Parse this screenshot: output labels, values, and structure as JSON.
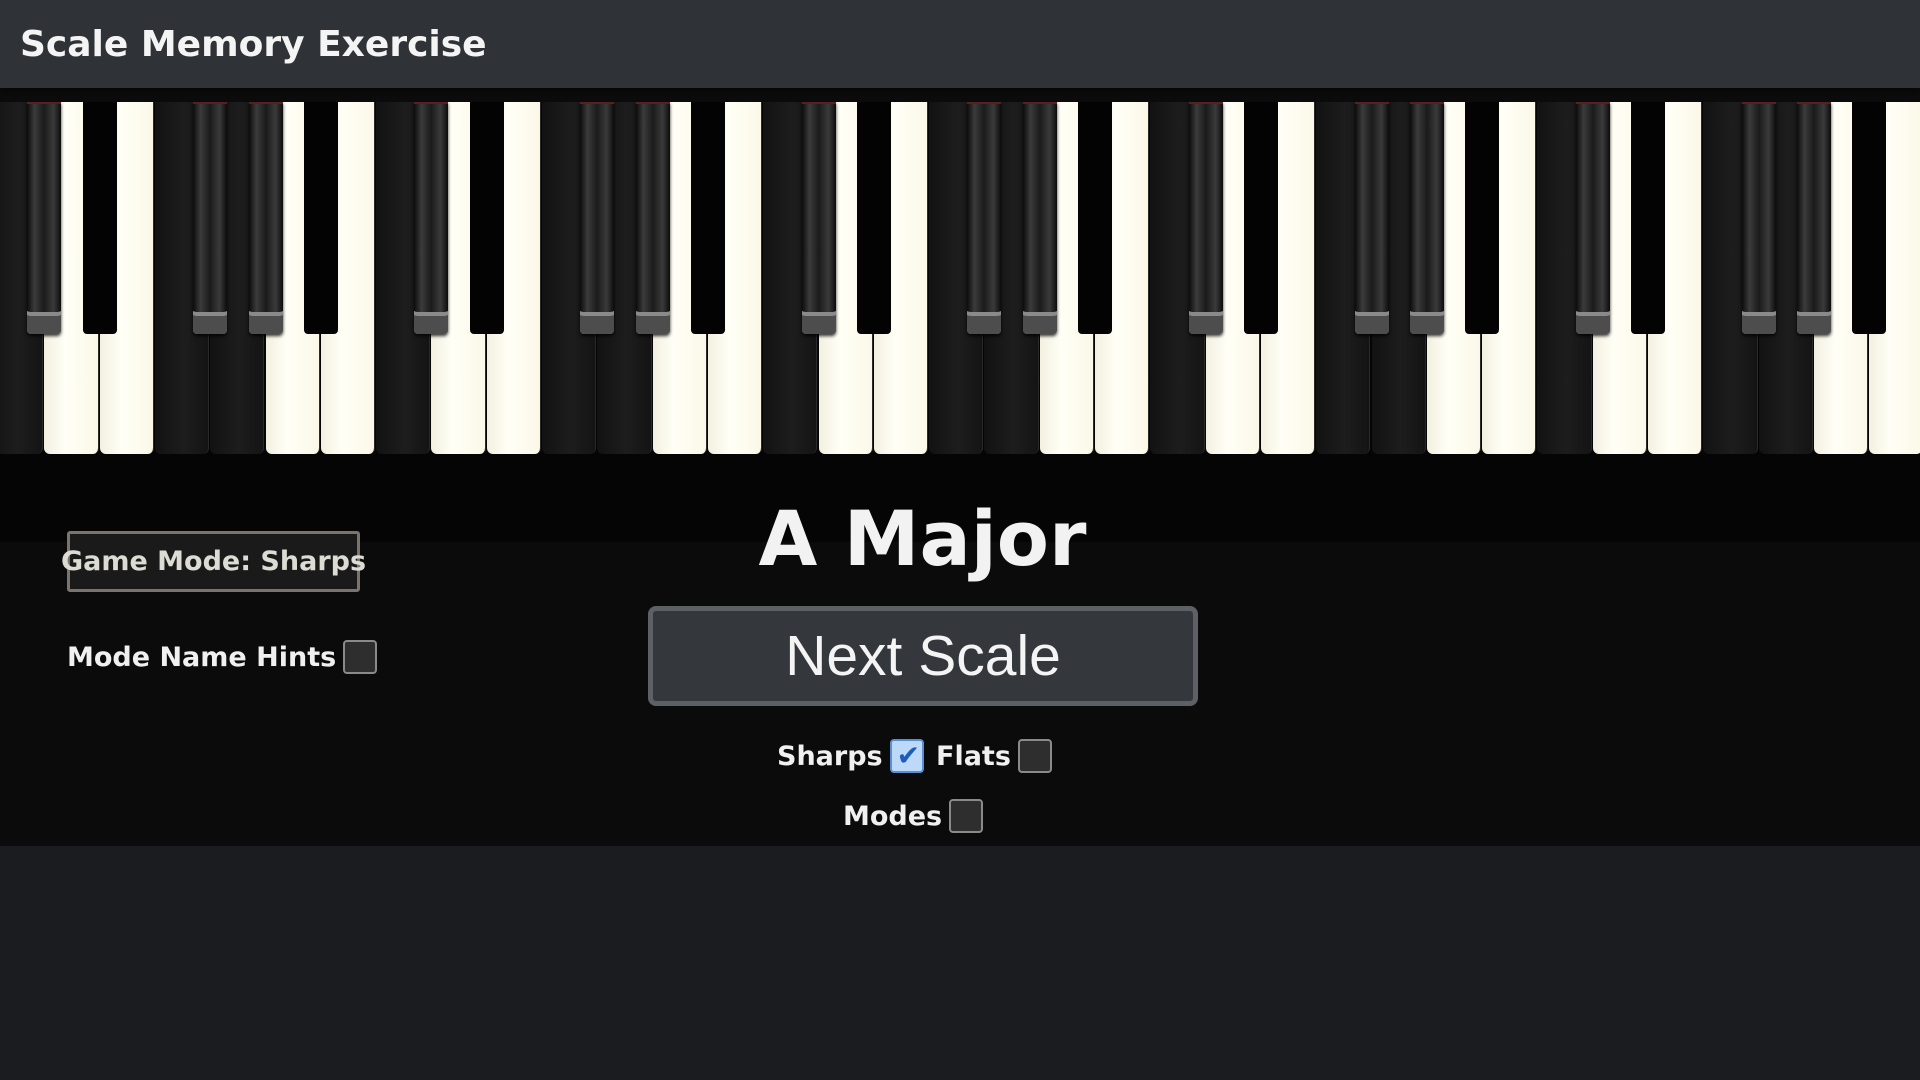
{
  "header": {
    "title": "Scale Memory Exercise"
  },
  "game": {
    "mode_button_label": "Game Mode: Sharps",
    "scale_name": "A Major",
    "next_button_label": "Next Scale"
  },
  "options": {
    "mode_name_hints": {
      "label": "Mode Name Hints",
      "checked": false
    },
    "sharps": {
      "label": "Sharps",
      "checked": true
    },
    "flats": {
      "label": "Flats",
      "checked": false
    },
    "modes": {
      "label": "Modes",
      "checked": false
    }
  },
  "colors": {
    "header_bg": "#2f3236",
    "stage_bg": "#0b0b0b",
    "page_bg": "#1a1c1f",
    "highlighted_white_key": "#fffff6",
    "checkbox_checked": "#bcd9f8"
  },
  "keyboard": {
    "pattern_note": "A major scale notes highlighted on keyboard",
    "highlighted_scale": "A Major"
  }
}
